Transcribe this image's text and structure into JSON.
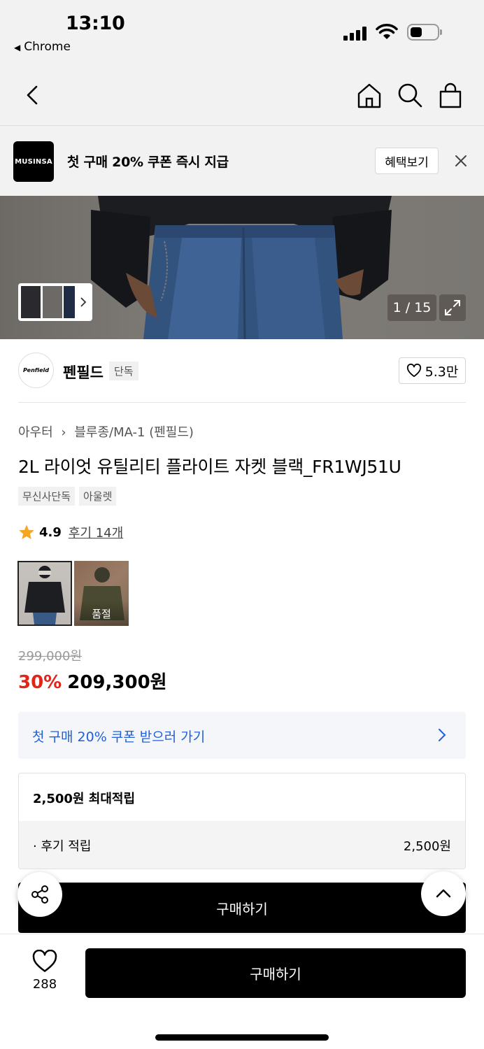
{
  "status": {
    "time": "13:10",
    "back_app": "Chrome"
  },
  "promo": {
    "logo": "MUSINSA",
    "text": "첫 구매 20% 쿠폰 즉시 지급",
    "button": "혜택보기"
  },
  "hero": {
    "counter": "1 / 15"
  },
  "brand": {
    "logo": "Penfield",
    "name": "펜필드",
    "exclusive": "단독",
    "likes": "5.3만"
  },
  "product": {
    "breadcrumb": [
      "아우터",
      "블루종/MA-1 (펜필드)"
    ],
    "title": "2L 라이엇 유틸리티 플라이트 자켓 블랙_FR1WJ51U",
    "tags": [
      "무신사단독",
      "아울렛"
    ],
    "rating": "4.9",
    "reviews": "후기 14개",
    "options": [
      {
        "label": ""
      },
      {
        "label": "품절"
      }
    ],
    "original_price": "299,000원",
    "discount": "30%",
    "price": "209,300원"
  },
  "coupon": {
    "text": "첫 구매 20% 쿠폰 받으러 가기"
  },
  "points": {
    "title": "2,500원 최대적립",
    "row_label": "· 후기 적립",
    "row_value": "2,500원"
  },
  "buy": {
    "label": "구매하기"
  },
  "bottom": {
    "like_count": "288",
    "buy_label": "구매하기"
  },
  "colors": {
    "accent_red": "#e1251b",
    "link_blue": "#1f5fd8",
    "black": "#000000"
  }
}
